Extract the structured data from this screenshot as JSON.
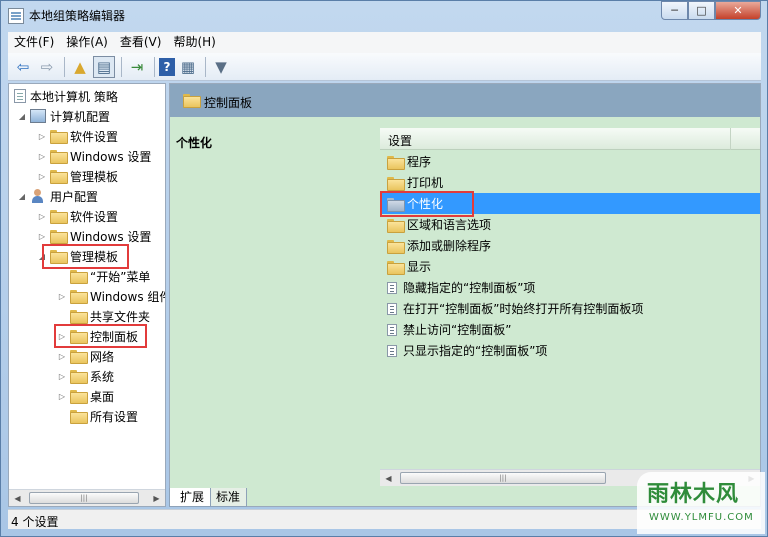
{
  "window": {
    "title": "本地组策略编辑器",
    "buttons": {
      "minimize": "─",
      "maximize": "□",
      "close": "✕"
    }
  },
  "menubar": [
    "文件(F)",
    "操作(A)",
    "查看(V)",
    "帮助(H)"
  ],
  "toolbar": {
    "icons": [
      "back-icon",
      "forward-icon",
      "up-folder-icon",
      "show-hide-tree-icon",
      "export-list-icon",
      "help-icon",
      "properties-icon",
      "filter-icon"
    ]
  },
  "tree": {
    "root": "本地计算机 策略",
    "computer_config": "计算机配置",
    "cc_software": "软件设置",
    "cc_windows": "Windows 设置",
    "cc_admin": "管理模板",
    "user_config": "用户配置",
    "uc_software": "软件设置",
    "uc_windows": "Windows 设置",
    "uc_admin": "管理模板",
    "start_menu": "“开始”菜单",
    "windows_components": "Windows 组件",
    "shared_folders": "共享文件夹",
    "control_panel": "控制面板",
    "network": "网络",
    "system": "系统",
    "desktop": "桌面",
    "all_settings": "所有设置"
  },
  "content": {
    "header_title": "控制面板",
    "selected_title": "个性化",
    "column_header": "设置",
    "folders": [
      "程序",
      "打印机",
      "个性化",
      "区域和语言选项",
      "添加或删除程序",
      "显示"
    ],
    "settings": [
      "隐藏指定的“控制面板”项",
      "在打开“控制面板”时始终打开所有控制面板项",
      "禁止访问“控制面板”",
      "只显示指定的“控制面板”项"
    ],
    "selected_index": 2
  },
  "tabs": [
    "扩展",
    "标准"
  ],
  "status": "4 个设置",
  "watermark": {
    "main": "雨林木风",
    "sub": "WWW.YLMFU.COM"
  },
  "colors": {
    "highlight": "#e23b3b",
    "selection": "#3399ff",
    "content_bg": "#cfe9d1"
  }
}
